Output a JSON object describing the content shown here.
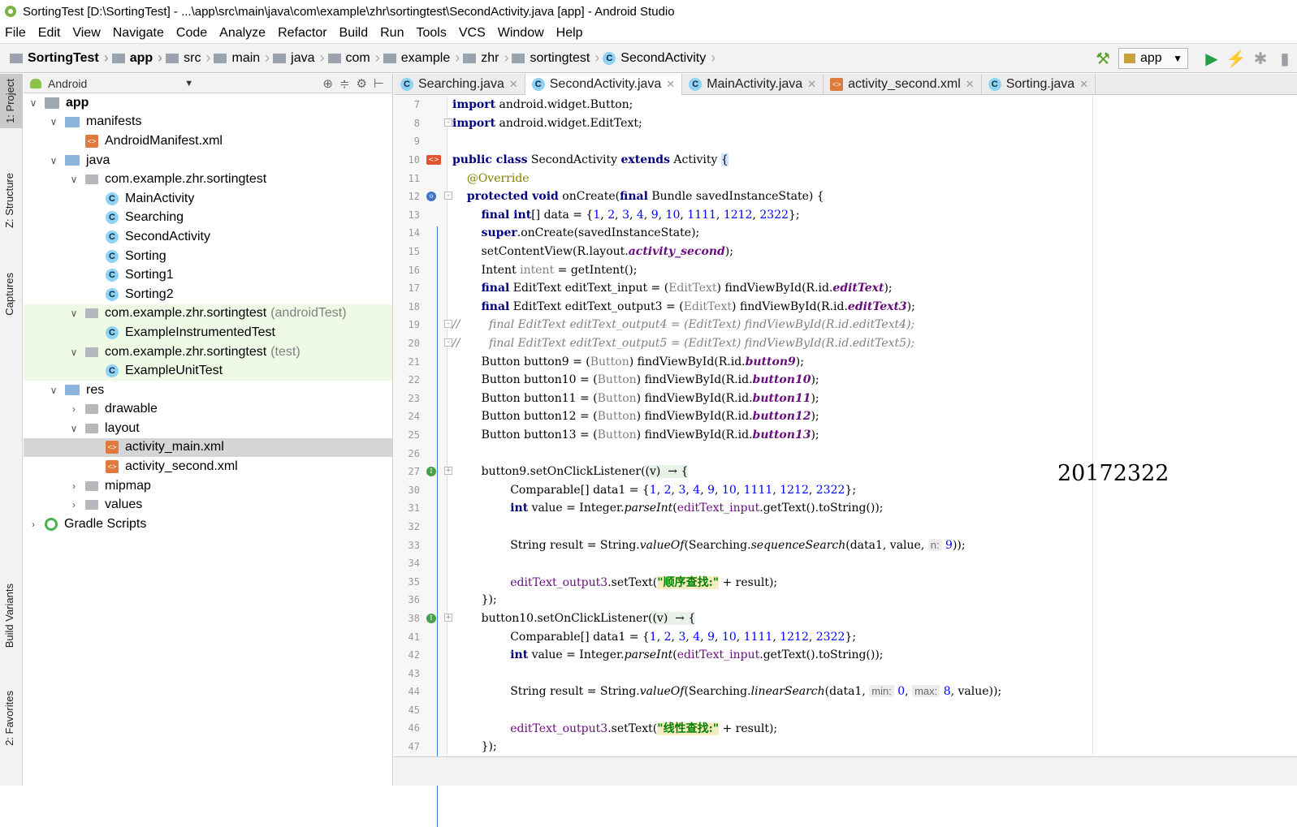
{
  "window": {
    "title": "SortingTest [D:\\SortingTest] - ...\\app\\src\\main\\java\\com\\example\\zhr\\sortingtest\\SecondActivity.java [app] - Android Studio"
  },
  "menu": [
    "File",
    "Edit",
    "View",
    "Navigate",
    "Code",
    "Analyze",
    "Refactor",
    "Build",
    "Run",
    "Tools",
    "VCS",
    "Window",
    "Help"
  ],
  "breadcrumb": [
    "SortingTest",
    "app",
    "src",
    "main",
    "java",
    "com",
    "example",
    "zhr",
    "sortingtest",
    "SecondActivity"
  ],
  "run_config": "app",
  "side_tabs": {
    "project": "1: Project",
    "structure": "Z: Structure",
    "captures": "Captures",
    "build_variants": "Build Variants",
    "favorites": "2: Favorites"
  },
  "project_panel": {
    "view_mode": "Android",
    "tree": [
      {
        "label": "app",
        "indent": 0,
        "arrow": "down",
        "icon": "app",
        "bold": true
      },
      {
        "label": "manifests",
        "indent": 1,
        "arrow": "down",
        "icon": "folder"
      },
      {
        "label": "AndroidManifest.xml",
        "indent": 2,
        "arrow": "",
        "icon": "xml"
      },
      {
        "label": "java",
        "indent": 1,
        "arrow": "down",
        "icon": "folder"
      },
      {
        "label": "com.example.zhr.sortingtest",
        "indent": 2,
        "arrow": "down",
        "icon": "pkg"
      },
      {
        "label": "MainActivity",
        "indent": 3,
        "arrow": "",
        "icon": "class"
      },
      {
        "label": "Searching",
        "indent": 3,
        "arrow": "",
        "icon": "class"
      },
      {
        "label": "SecondActivity",
        "indent": 3,
        "arrow": "",
        "icon": "class"
      },
      {
        "label": "Sorting",
        "indent": 3,
        "arrow": "",
        "icon": "class"
      },
      {
        "label": "Sorting1",
        "indent": 3,
        "arrow": "",
        "icon": "class"
      },
      {
        "label": "Sorting2",
        "indent": 3,
        "arrow": "",
        "icon": "class"
      },
      {
        "label": "com.example.zhr.sortingtest",
        "suffix": "(androidTest)",
        "indent": 2,
        "arrow": "down",
        "icon": "pkg",
        "green": true
      },
      {
        "label": "ExampleInstrumentedTest",
        "indent": 3,
        "arrow": "",
        "icon": "class",
        "green": true
      },
      {
        "label": "com.example.zhr.sortingtest",
        "suffix": "(test)",
        "indent": 2,
        "arrow": "down",
        "icon": "pkg",
        "green": true
      },
      {
        "label": "ExampleUnitTest",
        "indent": 3,
        "arrow": "",
        "icon": "class",
        "green": true
      },
      {
        "label": "res",
        "indent": 1,
        "arrow": "down",
        "icon": "folder"
      },
      {
        "label": "drawable",
        "indent": 2,
        "arrow": "right",
        "icon": "pkg"
      },
      {
        "label": "layout",
        "indent": 2,
        "arrow": "down",
        "icon": "pkg"
      },
      {
        "label": "activity_main.xml",
        "indent": 3,
        "arrow": "",
        "icon": "xml",
        "selected": true
      },
      {
        "label": "activity_second.xml",
        "indent": 3,
        "arrow": "",
        "icon": "xml"
      },
      {
        "label": "mipmap",
        "indent": 2,
        "arrow": "right",
        "icon": "pkg"
      },
      {
        "label": "values",
        "indent": 2,
        "arrow": "right",
        "icon": "pkg"
      },
      {
        "label": "Gradle Scripts",
        "indent": 0,
        "arrow": "right",
        "icon": "gradle"
      }
    ]
  },
  "editor_tabs": [
    {
      "label": "Searching.java",
      "icon": "class",
      "active": false
    },
    {
      "label": "SecondActivity.java",
      "icon": "class",
      "active": true
    },
    {
      "label": "MainActivity.java",
      "icon": "class",
      "active": false
    },
    {
      "label": "activity_second.xml",
      "icon": "xml",
      "active": false
    },
    {
      "label": "Sorting.java",
      "icon": "class",
      "active": false
    }
  ],
  "code_lines": [
    {
      "n": "7",
      "html": "<span class='kw'>import</span> android.widget.Button;"
    },
    {
      "n": "8",
      "html": "<span class='kw'>import</span> android.widget.EditText;",
      "fold": "-"
    },
    {
      "n": "9",
      "html": ""
    },
    {
      "n": "10",
      "html": "<span class='kw'>public class</span> SecondActivity <span class='kw'>extends</span> Activity <span class='caretbox'>{</span>",
      "mark": "red"
    },
    {
      "n": "11",
      "html": "    <span class='ann'>@Override</span>"
    },
    {
      "n": "12",
      "html": "    <span class='kw'>protected void</span> onCreate(<span class='kw'>final</span> Bundle savedInstanceState) {",
      "mark": "blue",
      "fold": "-"
    },
    {
      "n": "13",
      "html": "        <span class='kw'>final int</span>[] data = {<span class='num'>1</span>, <span class='num'>2</span>, <span class='num'>3</span>, <span class='num'>4</span>, <span class='num'>9</span>, <span class='num'>10</span>, <span class='num'>1111</span>, <span class='num'>1212</span>, <span class='num'>2322</span>};"
    },
    {
      "n": "14",
      "html": "        <span class='kw'>super</span>.onCreate(savedInstanceState);"
    },
    {
      "n": "15",
      "html": "        setContentView(R.layout.<span class='field'>activity_second</span>);"
    },
    {
      "n": "16",
      "html": "        Intent <span class='gray'>intent</span> = getIntent();"
    },
    {
      "n": "17",
      "html": "        <span class='kw'>final</span> EditText editText_input = (<span class='gray'>EditText</span>) findViewById(R.id.<span class='field'>editText</span>);"
    },
    {
      "n": "18",
      "html": "        <span class='kw'>final</span> EditText editText_output3 = (<span class='gray'>EditText</span>) findViewById(R.id.<span class='field'>editText3</span>);"
    },
    {
      "n": "19",
      "html": "<span class='com'>//        final EditText editText_output4 = (EditText) findViewById(R.id.editText4);</span>",
      "fold": "-"
    },
    {
      "n": "20",
      "html": "<span class='com'>//        final EditText editText_output5 = (EditText) findViewById(R.id.editText5);</span>",
      "fold": "-"
    },
    {
      "n": "21",
      "html": "        Button button9 = (<span class='gray'>Button</span>) findViewById(R.id.<span class='field'>button9</span>);"
    },
    {
      "n": "22",
      "html": "        Button button10 = (<span class='gray'>Button</span>) findViewById(R.id.<span class='field'>button10</span>);"
    },
    {
      "n": "23",
      "html": "        Button button11 = (<span class='gray'>Button</span>) findViewById(R.id.<span class='field'>button11</span>);"
    },
    {
      "n": "24",
      "html": "        Button button12 = (<span class='gray'>Button</span>) findViewById(R.id.<span class='field'>button12</span>);"
    },
    {
      "n": "25",
      "html": "        Button button13 = (<span class='gray'>Button</span>) findViewById(R.id.<span class='field'>button13</span>);"
    },
    {
      "n": "26",
      "html": ""
    },
    {
      "n": "27",
      "html": "        button9.setOnClickListener(<span class='lambda'>(v) &nbsp;→ {</span>",
      "mark": "green",
      "fold": "+"
    },
    {
      "n": "30",
      "html": "                Comparable[] data1 = {<span class='num'>1</span>, <span class='num'>2</span>, <span class='num'>3</span>, <span class='num'>4</span>, <span class='num'>9</span>, <span class='num'>10</span>, <span class='num'>1111</span>, <span class='num'>1212</span>, <span class='num'>2322</span>};"
    },
    {
      "n": "31",
      "html": "                <span class='kw'>int</span> value = Integer.<span class='it'>parseInt</span>(<span class='fieldv'>editText_input</span>.getText().toString());"
    },
    {
      "n": "32",
      "html": ""
    },
    {
      "n": "33",
      "html": "                String result = String.<span class='it'>valueOf</span>(Searching.<span class='it'>sequenceSearch</span>(data1, value, <span class='hint'>n:</span> <span class='num'>9</span>));"
    },
    {
      "n": "34",
      "html": ""
    },
    {
      "n": "35",
      "html": "                <span class='fieldv'>editText_output3</span>.setText(<span class='str'>\"顺序查找:\"</span> + result);"
    },
    {
      "n": "36",
      "html": "        });"
    },
    {
      "n": "38",
      "html": "        button10.setOnClickListener(<span class='lambda'>(v) &nbsp;→ {</span>",
      "mark": "green",
      "fold": "+"
    },
    {
      "n": "41",
      "html": "                Comparable[] data1 = {<span class='num'>1</span>, <span class='num'>2</span>, <span class='num'>3</span>, <span class='num'>4</span>, <span class='num'>9</span>, <span class='num'>10</span>, <span class='num'>1111</span>, <span class='num'>1212</span>, <span class='num'>2322</span>};"
    },
    {
      "n": "42",
      "html": "                <span class='kw'>int</span> value = Integer.<span class='it'>parseInt</span>(<span class='fieldv'>editText_input</span>.getText().toString());"
    },
    {
      "n": "43",
      "html": ""
    },
    {
      "n": "44",
      "html": "                String result = String.<span class='it'>valueOf</span>(Searching.<span class='it'>linearSearch</span>(data1, <span class='hint'>min:</span> <span class='num'>0</span>, <span class='hint'>max:</span> <span class='num'>8</span>, value));"
    },
    {
      "n": "45",
      "html": ""
    },
    {
      "n": "46",
      "html": "                <span class='fieldv'>editText_output3</span>.setText(<span class='str'>\"线性查找:\"</span> + result);"
    },
    {
      "n": "47",
      "html": "        });"
    }
  ],
  "watermark": "20172322"
}
